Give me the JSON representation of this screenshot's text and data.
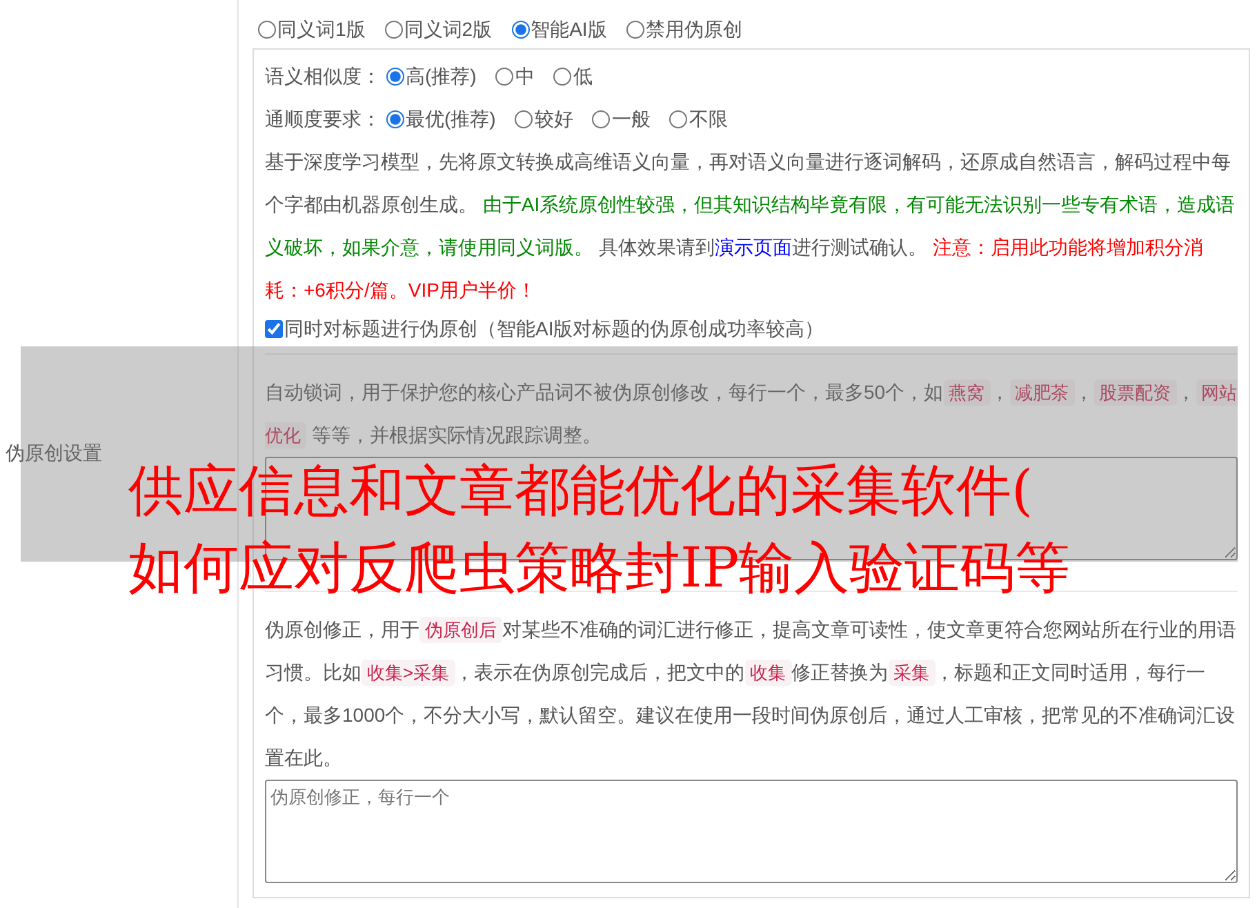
{
  "section_label": "伪原创设置",
  "mode_options": [
    {
      "label": "同义词1版",
      "selected": false
    },
    {
      "label": "同义词2版",
      "selected": false
    },
    {
      "label": "智能AI版",
      "selected": true
    },
    {
      "label": "禁用伪原创",
      "selected": false
    }
  ],
  "similarity": {
    "label": "语义相似度：",
    "options": [
      {
        "label": "高(推荐)",
        "selected": true
      },
      {
        "label": "中",
        "selected": false
      },
      {
        "label": "低",
        "selected": false
      }
    ]
  },
  "fluency": {
    "label": "通顺度要求：",
    "options": [
      {
        "label": "最优(推荐)",
        "selected": true
      },
      {
        "label": "较好",
        "selected": false
      },
      {
        "label": "一般",
        "selected": false
      },
      {
        "label": "不限",
        "selected": false
      }
    ]
  },
  "ai_description": [
    {
      "kind": "text",
      "text": "基于深度学习模型，先将原文转换成高维语义向量，再对语义向量进行逐词解码，还原成自然语言，解码过程中每个字都由机器原创生成。 "
    },
    {
      "kind": "green",
      "text": "由于AI系统原创性较强，但其知识结构毕竟有限，有可能无法识别一些专有术语，造成语义破坏，如果介意，请使用同义词版。"
    },
    {
      "kind": "text",
      "text": " 具体效果请到"
    },
    {
      "kind": "link",
      "text": "演示页面"
    },
    {
      "kind": "text",
      "text": "进行测试确认。 "
    },
    {
      "kind": "red",
      "text": "注意：启用此功能将增加积分消耗：+6积分/篇。VIP用户半价！"
    }
  ],
  "title_checkbox": {
    "label": "同时对标题进行伪原创（智能AI版对标题的伪原创成功率较高）",
    "checked": true
  },
  "lock_words": {
    "description": [
      {
        "kind": "text",
        "text": "自动锁词，用于保护您的核心产品词不被伪原创修改，每行一个，最多50个，如"
      },
      {
        "kind": "code",
        "text": "燕窝"
      },
      {
        "kind": "text",
        "text": "，"
      },
      {
        "kind": "code",
        "text": "减肥茶"
      },
      {
        "kind": "text",
        "text": "，"
      },
      {
        "kind": "code",
        "text": "股票配资"
      },
      {
        "kind": "text",
        "text": "，"
      },
      {
        "kind": "code",
        "text": "网站优化"
      },
      {
        "kind": "text",
        "text": " 等等，并根据实际情况跟踪调整。"
      }
    ]
  },
  "correction": {
    "description": [
      {
        "kind": "text",
        "text": "伪原创修正，用于"
      },
      {
        "kind": "code",
        "text": "伪原创后"
      },
      {
        "kind": "text",
        "text": "对某些不准确的词汇进行修正，提高文章可读性，使文章更符合您网站所在行业的用语习惯。比如"
      },
      {
        "kind": "code",
        "text": "收集>采集"
      },
      {
        "kind": "text",
        "text": "，表示在伪原创完成后，把文中的"
      },
      {
        "kind": "code",
        "text": "收集"
      },
      {
        "kind": "text",
        "text": "修正替换为"
      },
      {
        "kind": "code",
        "text": "采集"
      },
      {
        "kind": "text",
        "text": "，标题和正文同时适用，每行一个，最多1000个，不分大小写，默认留空。建议在使用一段时间伪原创后，通过人工审核，把常见的不准确词汇设置在此。"
      }
    ],
    "placeholder": "伪原创修正，每行一个"
  },
  "overlay_title": [
    "供应信息和文章都能优化的采集软件(",
    "如何应对反爬虫策略封IP输入验证码等"
  ]
}
